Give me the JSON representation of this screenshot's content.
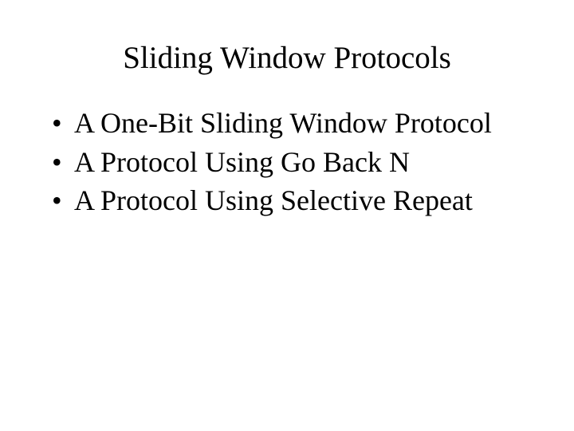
{
  "slide": {
    "title": "Sliding Window Protocols",
    "bullets": [
      "A One-Bit Sliding Window Protocol",
      "A Protocol Using Go Back N",
      "A Protocol Using Selective Repeat"
    ]
  }
}
